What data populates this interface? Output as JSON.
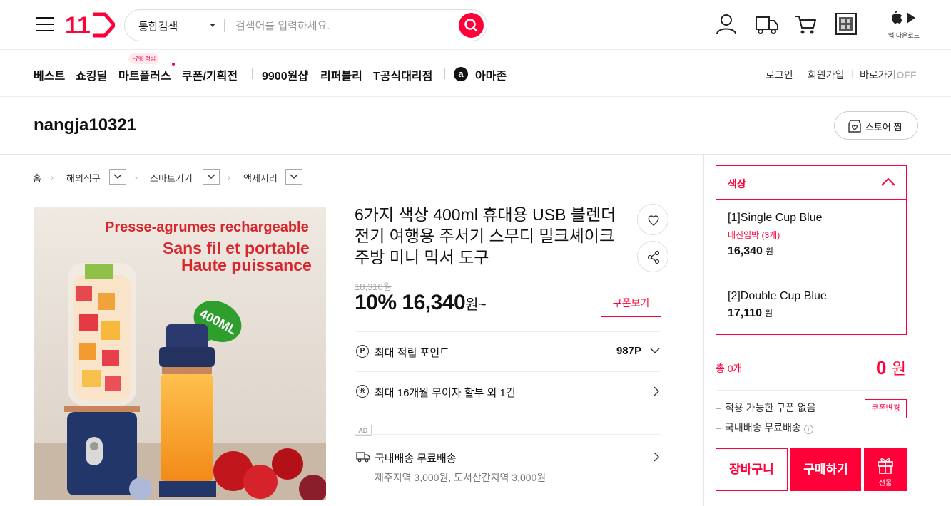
{
  "header": {
    "logo": "11",
    "search": {
      "category": "통합검색",
      "placeholder": "검색어를 입력하세요."
    },
    "app_download": "앱 다운로드"
  },
  "nav": {
    "items": [
      "베스트",
      "쇼킹딜",
      "마트플러스",
      "쿠폰/기획전",
      "9900원샵",
      "리퍼블리",
      "T공식대리점",
      "아마존"
    ],
    "mart_badge": "~7% 적립",
    "amazon_letter": "a",
    "util": [
      "로그인",
      "회원가입",
      "바로가기"
    ],
    "off_label": "OFF"
  },
  "store": {
    "name": "nangja10321",
    "zzim_label": "스토어 찜"
  },
  "breadcrumb": [
    "홈",
    "해외직구",
    "스마트기기",
    "액세서리"
  ],
  "product": {
    "image_text": {
      "line1": "Presse-agrumes rechargeable",
      "line2": "Sans fil et portable",
      "line3": "Haute puissance",
      "sticker": "400ML"
    },
    "title": "6가지 색상 400ml 휴대용 USB 블렌더 전기 여행용 주서기 스무디 밀크셰이크 주방 미니 믹서 도구",
    "original_price": "18,310원",
    "discount": "10%",
    "price": "16,340",
    "price_unit": "원~",
    "coupon_label": "쿠폰보기",
    "point_icon": "P",
    "point_label": "최대 적립 포인트",
    "point_value": "987P",
    "installment_icon": "%",
    "installment_label": "최대 16개월 무이자 할부 외 1건",
    "ad_tag": "AD",
    "shipping_label": "국내배송 무료배송",
    "shipping_sub": "제주지역 3,000원, 도서산간지역 3,000원"
  },
  "options": {
    "header": "색상",
    "items": [
      {
        "name": "[1]Single Cup Blue",
        "stock": "매진임박 (3개)",
        "price": "16,340",
        "unit": "원"
      },
      {
        "name": "[2]Double Cup Blue",
        "stock": "",
        "price": "17,110",
        "unit": "원"
      }
    ]
  },
  "order": {
    "total_label": "총 0개",
    "total_value": "0",
    "total_unit": "원",
    "coupon_none": "적용 가능한 쿠폰 없음",
    "coupon_change": "쿠폰변경",
    "domestic_shipping": "국내배송 무료배송",
    "info_icon": "i",
    "cart": "장바구니",
    "buy": "구매하기",
    "gift": "선물"
  },
  "colors": {
    "accent": "#ff0038",
    "text": "#111111"
  }
}
